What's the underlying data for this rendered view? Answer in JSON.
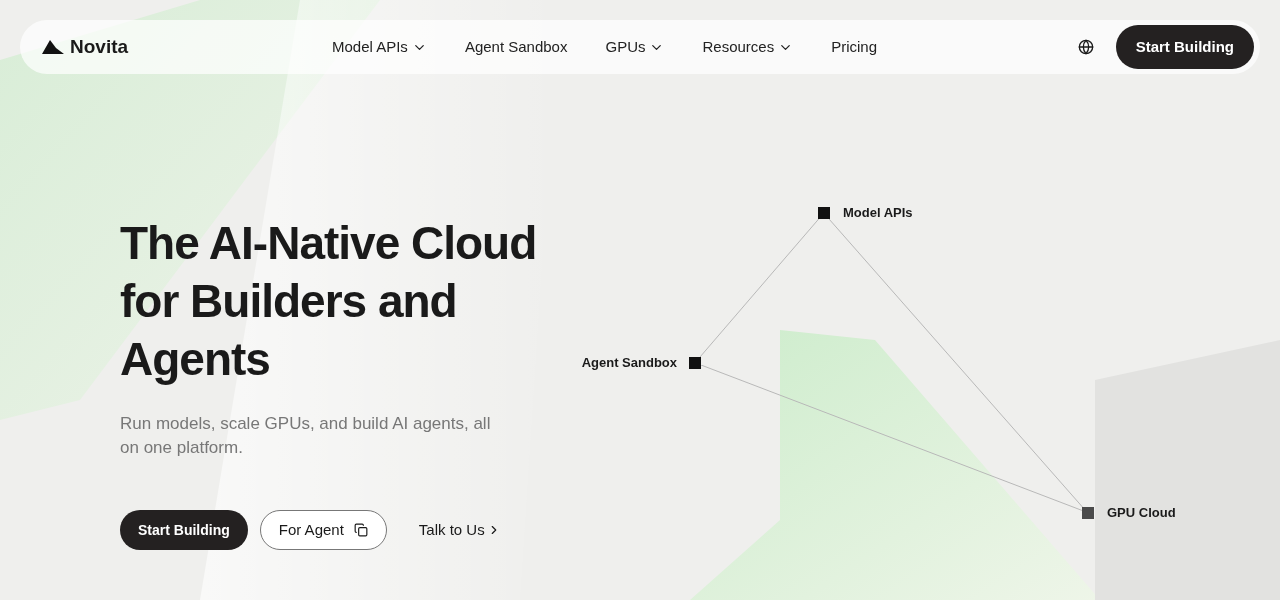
{
  "nav": {
    "brand": "Novita",
    "items": [
      {
        "label": "Model APIs",
        "has_menu": true
      },
      {
        "label": "Agent Sandbox",
        "has_menu": false
      },
      {
        "label": "GPUs",
        "has_menu": true
      },
      {
        "label": "Resources",
        "has_menu": true
      },
      {
        "label": "Pricing",
        "has_menu": false
      }
    ],
    "cta": "Start Building"
  },
  "hero": {
    "title": "The AI-Native Cloud for Builders and Agents",
    "subtitle": "Run models, scale GPUs, and build AI agents, all on one platform.",
    "primary": "Start Building",
    "secondary": "For Agent",
    "link": "Talk to Us"
  },
  "diagram": {
    "nodes": [
      {
        "label": "Model APIs",
        "color": "#111111"
      },
      {
        "label": "Agent Sandbox",
        "color": "#111111"
      },
      {
        "label": "GPU Cloud",
        "color": "#4a4a4a"
      }
    ]
  }
}
